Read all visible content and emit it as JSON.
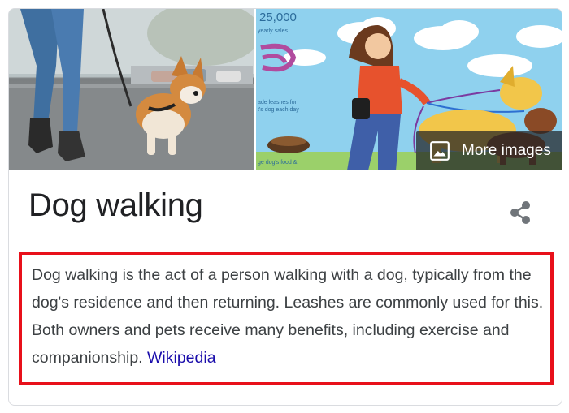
{
  "panel": {
    "title": "Dog walking",
    "more_images_label": "More images",
    "description": "Dog walking is the act of a person walking with a dog, typically from the dog's residence and then returning. Leashes are commonly used for this. Both owners and pets receive many benefits, including exercise and companionship.",
    "source_link": "Wikipedia"
  },
  "infographic": {
    "headline": "25,000",
    "lines": [
      "yearly sales",
      "ade leashes for",
      "t's dog each day",
      "ge dog's food &"
    ]
  },
  "colors": {
    "highlight_border": "#e8101a",
    "link": "#1a0dab",
    "title_text": "#202124",
    "body_text": "#3c4043"
  },
  "icons": {
    "more_images": "image-icon",
    "share": "share-icon"
  }
}
